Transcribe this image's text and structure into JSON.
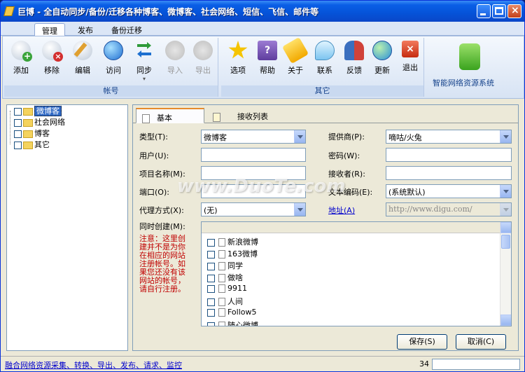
{
  "window": {
    "title": "巨博 - 全自动同步/备份/迁移各种博客、微博客、社会网络、短信、飞信、邮件等"
  },
  "ribbon": {
    "tabs": [
      {
        "label": "管理",
        "active": true
      },
      {
        "label": "发布",
        "active": false
      },
      {
        "label": "备份迁移",
        "active": false
      }
    ],
    "groups": {
      "account": {
        "label": "帐号",
        "buttons": [
          {
            "label": "添加",
            "icon": "add-icon",
            "enabled": true
          },
          {
            "label": "移除",
            "icon": "remove-icon",
            "enabled": true
          },
          {
            "label": "编辑",
            "icon": "edit-icon",
            "enabled": true
          },
          {
            "label": "访问",
            "icon": "globe-icon",
            "enabled": true
          },
          {
            "label": "同步",
            "icon": "sync-icon",
            "enabled": true
          },
          {
            "label": "导入",
            "icon": "import-icon",
            "enabled": false
          },
          {
            "label": "导出",
            "icon": "export-icon",
            "enabled": false
          }
        ]
      },
      "other": {
        "label": "其它",
        "buttons": [
          {
            "label": "选项",
            "icon": "star-icon",
            "enabled": true
          },
          {
            "label": "帮助",
            "icon": "help-book-icon",
            "enabled": true
          },
          {
            "label": "关于",
            "icon": "tag-icon",
            "enabled": true
          },
          {
            "label": "联系",
            "icon": "chat-bubble-icon",
            "enabled": true
          },
          {
            "label": "反馈",
            "icon": "users-icon",
            "enabled": true
          },
          {
            "label": "更新",
            "icon": "update-globe-icon",
            "enabled": true
          },
          {
            "label": "退出",
            "icon": "exit-icon",
            "enabled": true
          }
        ]
      },
      "brand": {
        "label": "智能网络资源系统",
        "icon": "puzzle-icon"
      }
    }
  },
  "tree": {
    "items": [
      {
        "label": "微博客",
        "selected": true
      },
      {
        "label": "社会网络",
        "selected": false
      },
      {
        "label": "博客",
        "selected": false
      },
      {
        "label": "其它",
        "selected": false
      }
    ]
  },
  "tabs": {
    "basic": "基本",
    "receivers": "接收列表"
  },
  "form": {
    "type_label": "类型(T):",
    "type_value": "微博客",
    "provider_label": "提供商(P):",
    "provider_value": "嘀咕/火兔",
    "user_label": "用户(U):",
    "user_value": "",
    "password_label": "密码(W):",
    "password_value": "",
    "project_label": "项目名称(M):",
    "project_value": "",
    "receiver_label": "接收者(R):",
    "receiver_value": "",
    "port_label": "端口(O):",
    "port_value": "",
    "encoding_label": "文本编码(E):",
    "encoding_value": "(系统默认)",
    "proxy_label": "代理方式(X):",
    "proxy_value": "(无)",
    "address_label": "地址(A)",
    "address_value": "http://www.digu.com/",
    "create_label": "同时创建(M):",
    "note": "注意：这里创建并不是为你在相应的网站注册帐号。如果您还没有该网站的帐号，请自行注册。"
  },
  "create_list": {
    "items": [
      "新浪微博",
      "163微博",
      "同学",
      "做啥",
      "9911",
      "人间",
      "Follow5",
      "随心微博"
    ]
  },
  "buttons": {
    "save": "保存(S)",
    "cancel": "取消(C)"
  },
  "statusbar": {
    "link": "融合网络资源采集、转换、导出、发布、请求、监控",
    "count": "34"
  },
  "watermark": "www.DuoTe.com"
}
